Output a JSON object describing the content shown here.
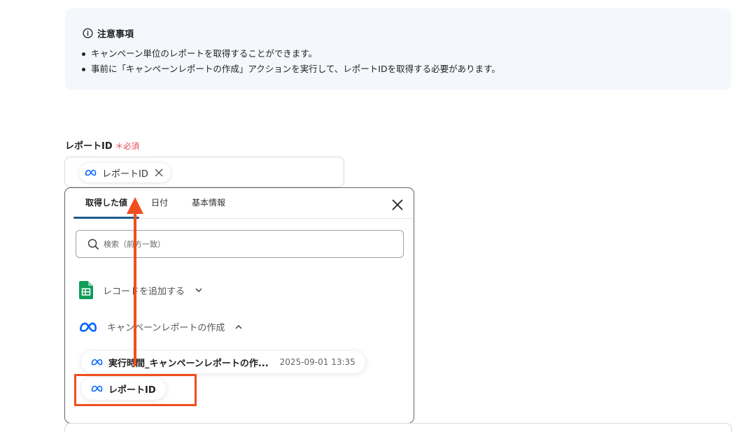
{
  "notice": {
    "title": "注意事項",
    "items": [
      "キャンペーン単位のレポートを取得することができます。",
      "事前に「キャンペーンレポートの作成」アクションを実行して、レポートIDを取得する必要があります。"
    ]
  },
  "field": {
    "label": "レポートID",
    "required_mark": "＊",
    "required_text": "必須",
    "chip_label": "レポートID"
  },
  "panel": {
    "tabs": [
      "取得した値",
      "日付",
      "基本情報"
    ],
    "active_tab": 0,
    "search_placeholder": "検索（前方一致）",
    "groups": [
      {
        "label": "レコードを追加する",
        "icon": "google-sheets-icon",
        "expanded": false
      },
      {
        "label": "キャンペーンレポートの作成",
        "icon": "meta-icon",
        "expanded": true
      }
    ],
    "items": [
      {
        "label": "実行時間_キャンペーンレポートの作...",
        "time": "2025-09-01 13:35"
      },
      {
        "label": "レポートID"
      }
    ]
  },
  "colors": {
    "accent_tab": "#1f5d8c",
    "highlight": "#f04e1e",
    "required": "#e5484d",
    "meta_blue": "#0866ff",
    "sheets_green": "#0f9d58"
  }
}
